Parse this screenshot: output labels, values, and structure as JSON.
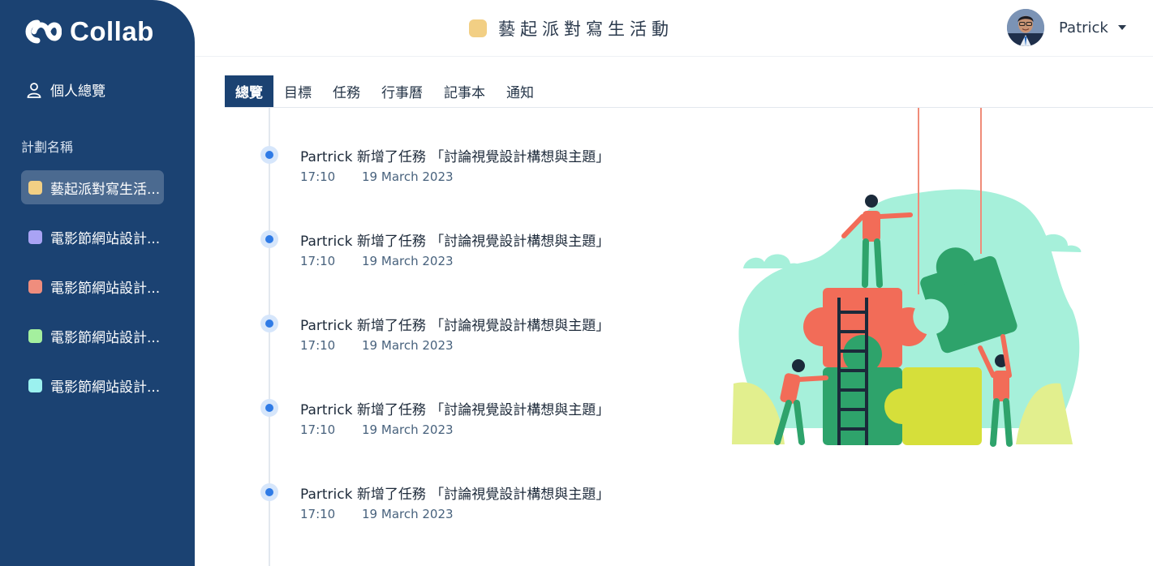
{
  "app": {
    "logo_text": "Collab"
  },
  "sidebar": {
    "personal_label": "個人總覽",
    "section_label": "計劃名稱",
    "projects": [
      {
        "label": "藝起派對寫生活...",
        "color": "#f2cf84"
      },
      {
        "label": "電影節網站設計...",
        "color": "#a9a3f4"
      },
      {
        "label": "電影節網站設計...",
        "color": "#ef8d7d"
      },
      {
        "label": "電影節網站設計...",
        "color": "#a4ef9e"
      },
      {
        "label": "電影節網站設計...",
        "color": "#9bf1ef"
      }
    ]
  },
  "header": {
    "title": "藝起派對寫生活動",
    "title_color": "#f2cf84",
    "user_name": "Patrick"
  },
  "tabs": [
    {
      "label": "總覽"
    },
    {
      "label": "目標"
    },
    {
      "label": "任務"
    },
    {
      "label": "行事曆"
    },
    {
      "label": "記事本"
    },
    {
      "label": "通知"
    }
  ],
  "activity": [
    {
      "text": "Partrick 新增了任務 「討論視覺設計構想與主題」",
      "time": "17:10",
      "date": "19 March 2023"
    },
    {
      "text": "Partrick 新增了任務 「討論視覺設計構想與主題」",
      "time": "17:10",
      "date": "19 March 2023"
    },
    {
      "text": "Partrick 新增了任務 「討論視覺設計構想與主題」",
      "time": "17:10",
      "date": "19 March 2023"
    },
    {
      "text": "Partrick 新增了任務 「討論視覺設計構想與主題」",
      "time": "17:10",
      "date": "19 March 2023"
    },
    {
      "text": "Partrick 新增了任務 「討論視覺設計構想與主題」",
      "time": "17:10",
      "date": "19 March 2023"
    }
  ],
  "colors": {
    "sidebar": "#1b4272",
    "accent_dot": "#2f7be6"
  },
  "illustration": {
    "icon": "teamwork-puzzle-illustration"
  }
}
